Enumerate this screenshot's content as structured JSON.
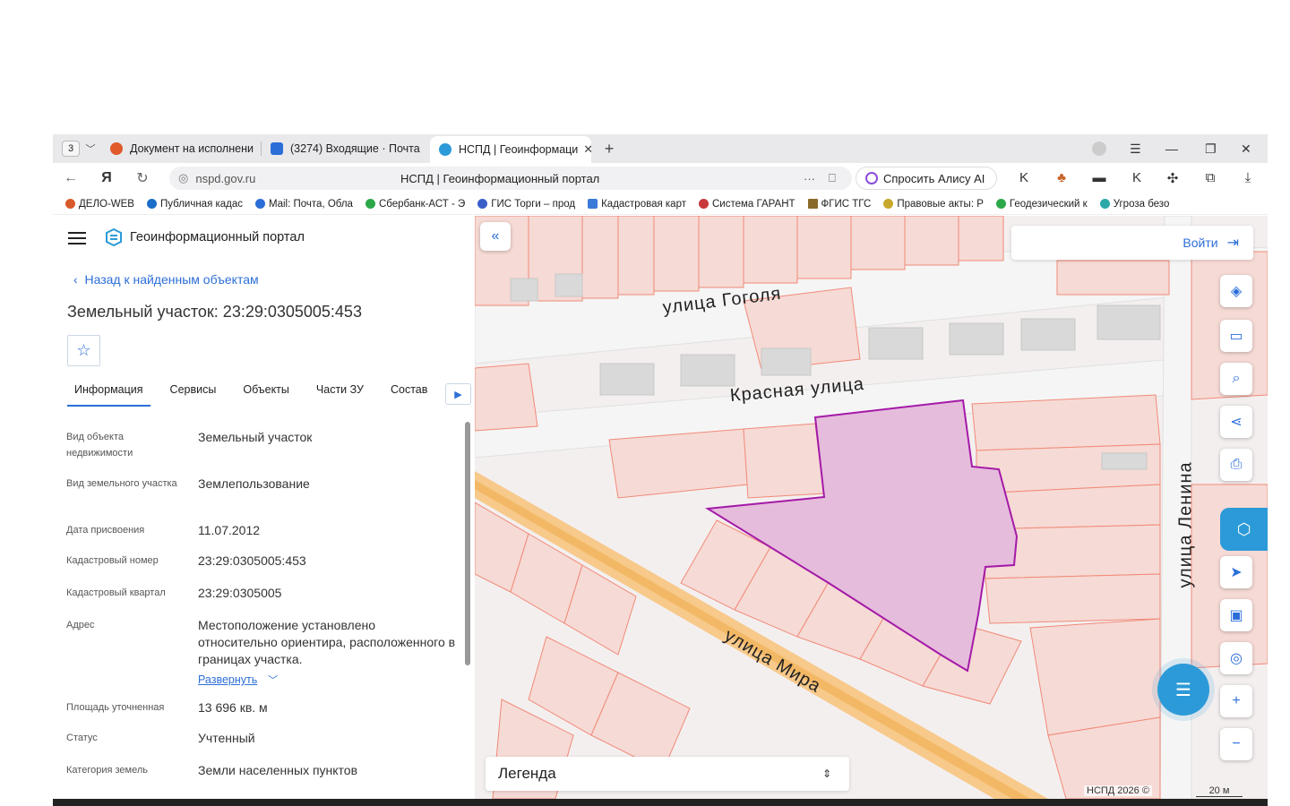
{
  "browser": {
    "tab_count": "3",
    "tabs": [
      {
        "label": "Документ на исполнени",
        "icon": "yandex-icon",
        "color": "#e05a2a"
      },
      {
        "label": "(3274) Входящие · Почта",
        "icon": "mail-icon",
        "color": "#2c6ed8"
      },
      {
        "label": "НСПД | Геоинформаци",
        "icon": "nspd-icon",
        "color": "#2c9ad8"
      }
    ],
    "url": "nspd.gov.ru",
    "page_title": "НСПД | Геоинформационный портал",
    "alice_label": "Спросить Алису AI",
    "bookmarks": [
      "ДЕЛО-WEB",
      "Публичная кадас",
      "Mail: Почта, Обла",
      "Сбербанк-АСТ - Э",
      "ГИС Торги – прод",
      "Кадастровая карт",
      "Система ГАРАНТ",
      "ФГИС ТГС",
      "Правовые акты: Р",
      "Геодезический к",
      "Угроза безо"
    ]
  },
  "panel": {
    "portal_name": "Геоинформационный портал",
    "back_label": "Назад к найденным объектам",
    "title": "Земельный участок: 23:29:0305005:453",
    "tabs": [
      "Информация",
      "Сервисы",
      "Объекты",
      "Части ЗУ",
      "Состав"
    ],
    "expand_label": "Развернуть",
    "fields": [
      {
        "label": "Вид объекта недвижимости",
        "value": "Земельный участок"
      },
      {
        "label": "Вид земельного участка",
        "value": "Землепользование"
      },
      {
        "label": "Дата присвоения",
        "value": "11.07.2012"
      },
      {
        "label": "Кадастровый номер",
        "value": "23:29:0305005:453"
      },
      {
        "label": "Кадастровый квартал",
        "value": "23:29:0305005"
      },
      {
        "label": "Адрес",
        "value": "Местоположение установлено относительно ориентира, расположенного в границах участка."
      },
      {
        "label": "Площадь уточненная",
        "value": "13 696 кв. м"
      },
      {
        "label": "Статус",
        "value": "Учтенный"
      },
      {
        "label": "Категория земель",
        "value": "Земли населенных пунктов"
      }
    ]
  },
  "map": {
    "login_label": "Войти",
    "legend_label": "Легенда",
    "copyright": "НСПД 2026 ©",
    "scale": "20 м",
    "streets": [
      "улица Гоголя",
      "Красная улица",
      "улица Мира",
      "улица Ленина"
    ],
    "parcel_color": "#e6bcdc",
    "parcel_stroke": "#a41aa8",
    "boundary_color": "#f08a78"
  }
}
